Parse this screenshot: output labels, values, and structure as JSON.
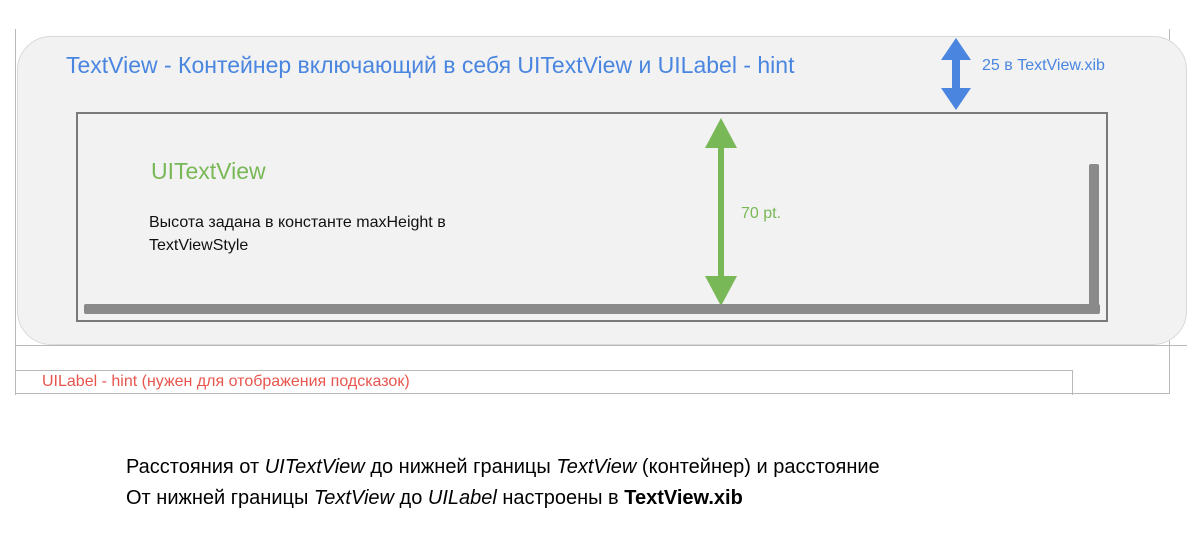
{
  "container": {
    "title": "TextView - Контейнер включающий в себя UITextView и UILabel - hint",
    "top_spacing_label": "25 в TextView.xib",
    "color": "#4a86e0"
  },
  "textview": {
    "label": "UITextView",
    "description": "Высота задана в константе maxHeight в TextViewStyle",
    "height_label": "70 pt.",
    "color": "#79b856"
  },
  "hint": {
    "label": "UILabel - hint (нужен для отображения подсказок)",
    "color": "#e8554e"
  },
  "caption": {
    "line1": {
      "t1": "Расстояния от ",
      "t2": "UITextView",
      "t3": " до нижней границы ",
      "t4": "TextView",
      "t5": " (контейнер) и расстояние"
    },
    "line2": {
      "t1": "От нижней границы ",
      "t2": "TextView",
      "t3": " до ",
      "t4": "UILabel",
      "t5": " настроены в ",
      "t6": "TextView.xib"
    }
  },
  "icons": {
    "blue_arrow": "double-arrow-vertical-icon",
    "green_arrow": "double-arrow-vertical-icon"
  }
}
